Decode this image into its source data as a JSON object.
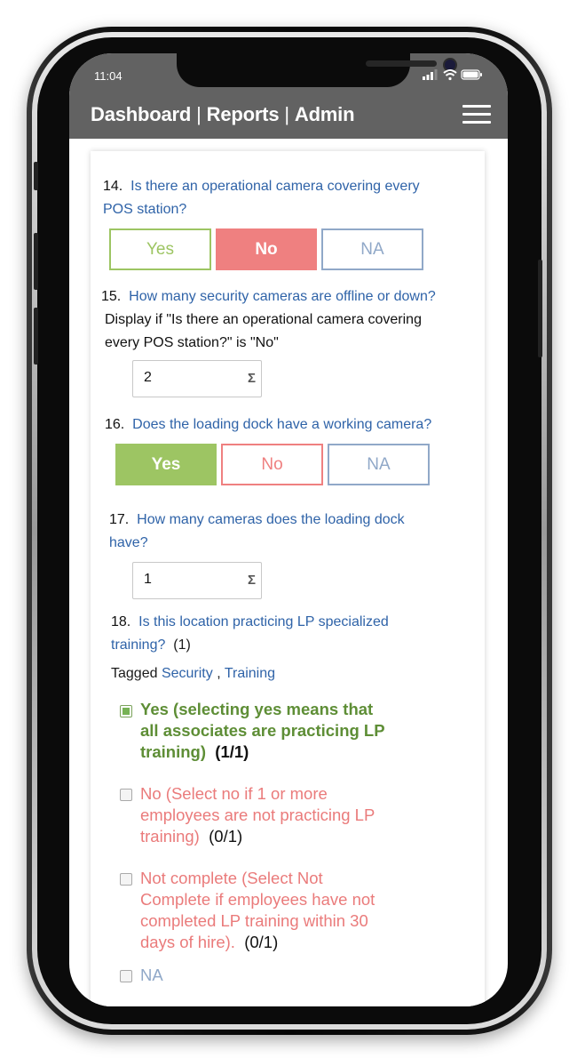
{
  "status": {
    "time": "11:04"
  },
  "nav": {
    "dashboard": "Dashboard",
    "reports": "Reports",
    "admin": "Admin",
    "separator": "|",
    "menu_icon": "hamburger-icon"
  },
  "questions": [
    {
      "number": "14.",
      "text": "Is there an operational camera covering every",
      "text2": "POS station?",
      "options": [
        "Yes",
        "No",
        "NA"
      ],
      "selected": "No"
    },
    {
      "number": "15.",
      "text": "How many security cameras are offline or down?",
      "condition1": "Display if \"Is there an operational camera covering",
      "condition2": "every POS station?\" is \"No\"",
      "value": "2"
    },
    {
      "number": "16.",
      "text": "Does the loading dock have a working camera?",
      "options": [
        "Yes",
        "No",
        "NA"
      ],
      "selected": "Yes"
    },
    {
      "number": "17.",
      "text": "How many cameras does the loading dock",
      "text2": "have?",
      "value": "1"
    },
    {
      "number": "18.",
      "text": "Is this location practicing LP specialized",
      "text2": "training?",
      "score": "(1)",
      "tagged_label": "Tagged",
      "tags": [
        "Security",
        "Training"
      ],
      "tag_sep": ",",
      "choices": [
        {
          "lines": [
            "Yes (selecting yes means that",
            "all associates are practicing LP",
            "training)"
          ],
          "score": "(1/1)",
          "checked": true
        },
        {
          "lines": [
            "No (Select no if 1 or more",
            "employees are not practicing LP",
            "training)"
          ],
          "score": "(0/1)",
          "checked": false
        },
        {
          "lines": [
            "Not complete (Select Not",
            "Complete if employees have not",
            "completed LP training within 30",
            "days of hire)."
          ],
          "score": "(0/1)",
          "checked": false
        },
        {
          "lines": [
            "NA"
          ],
          "score": "",
          "checked": false
        }
      ]
    }
  ],
  "input_icon": "sigma-icon",
  "sigma_glyph": "Σ",
  "colors": {
    "yes_green": "#9dc563",
    "no_red": "#ef8080",
    "na_blue": "#90a8c8",
    "link_blue": "#2f63a8",
    "header_gray": "#626262"
  }
}
